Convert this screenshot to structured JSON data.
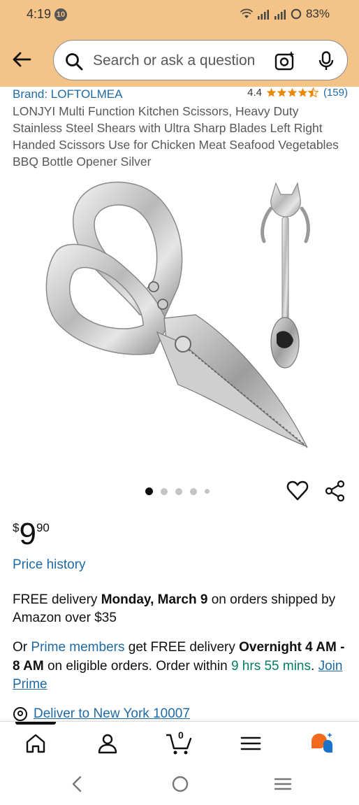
{
  "status_bar": {
    "time": "4:19",
    "notification_count": "10",
    "battery": "83%"
  },
  "search": {
    "placeholder": "Search or ask a question"
  },
  "product": {
    "brand": "Brand: LOFTOLMEA",
    "rating": "4.4",
    "rating_stars": 4.5,
    "review_count": "(159)",
    "title": "LONJYI Multi Function Kitchen Scissors, Heavy Duty Stainless Steel Shears with Ultra Sharp Blades Left Right Handed Scissors Use for Chicken Meat Seafood Vegetables BBQ Bottle Opener Silver",
    "image_count": 5,
    "active_image": 1
  },
  "price": {
    "symbol": "$",
    "whole": "9",
    "fraction": "90",
    "history_label": "Price history"
  },
  "delivery": {
    "line1_prefix": "FREE delivery ",
    "line1_date": "Monday, March 9",
    "line1_suffix": " on orders shipped by Amazon over $35",
    "line2_or": "Or ",
    "line2_prime_link": "Prime members",
    "line2_get": " get FREE delivery ",
    "line2_speed": "Overnight 4 AM - 8 AM",
    "line2_on": " on eligible orders. Order within ",
    "line2_countdown": "9 hrs 55 mins",
    "line2_period": ". ",
    "line2_join": "Join Prime"
  },
  "deliver_to": {
    "label": "Deliver to New York 10007"
  },
  "bottom_nav": {
    "cart_count": "0",
    "items": [
      "home",
      "account",
      "cart",
      "menu",
      "rufus"
    ]
  },
  "colors": {
    "header_bg": "#f3c388",
    "link": "#1f6aa5",
    "star": "#e8890c",
    "green": "#067d62"
  }
}
